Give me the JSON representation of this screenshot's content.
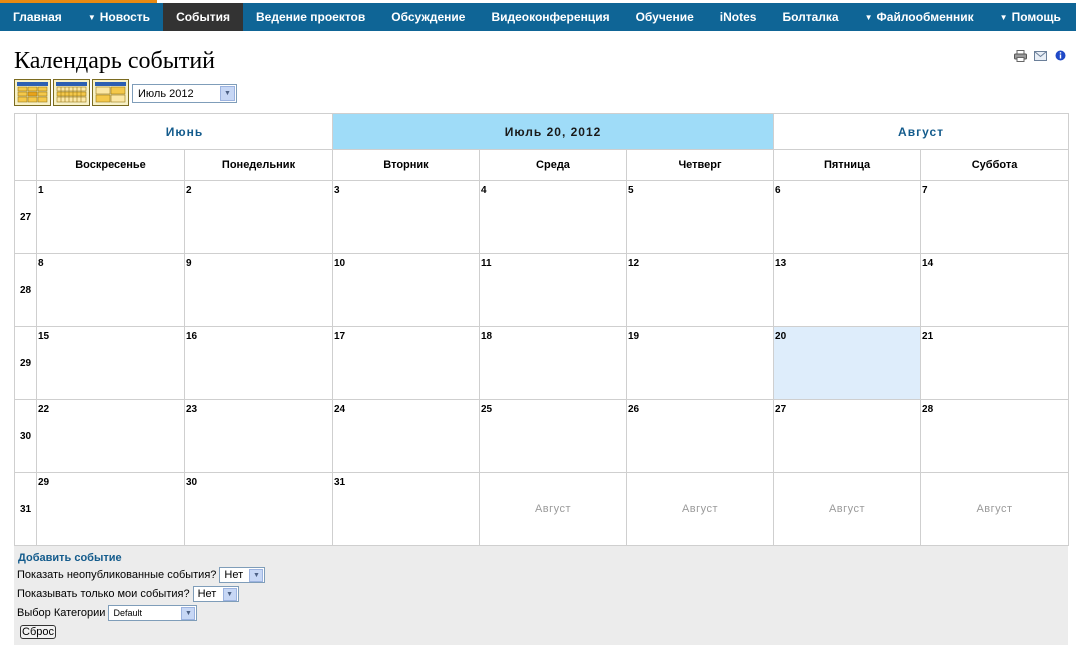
{
  "nav": {
    "items": [
      {
        "label": "Главная",
        "has_dropdown": false,
        "active": false
      },
      {
        "label": "Новость",
        "has_dropdown": true,
        "active": false
      },
      {
        "label": "События",
        "has_dropdown": false,
        "active": true
      },
      {
        "label": "Ведение проектов",
        "has_dropdown": false,
        "active": false
      },
      {
        "label": "Обсуждение",
        "has_dropdown": false,
        "active": false
      },
      {
        "label": "Видеоконференция",
        "has_dropdown": false,
        "active": false
      },
      {
        "label": "Обучение",
        "has_dropdown": false,
        "active": false
      },
      {
        "label": "iNotes",
        "has_dropdown": false,
        "active": false
      },
      {
        "label": "Болталка",
        "has_dropdown": false,
        "active": false
      },
      {
        "label": "Файлообменник",
        "has_dropdown": true,
        "active": false
      },
      {
        "label": "Помощь",
        "has_dropdown": true,
        "active": false
      }
    ],
    "dropdown_glyph": "▼"
  },
  "page": {
    "title": "Календарь событий",
    "tools": [
      "printer-icon",
      "email-icon",
      "info-icon"
    ]
  },
  "views": [
    "day-view-icon",
    "week-view-icon",
    "month-view-icon"
  ],
  "month_select": {
    "value": "Июль 2012"
  },
  "calendar": {
    "prev_month": "Июнь",
    "current": "Июль 20, 2012",
    "next_month": "Август",
    "weekdays": [
      "Воскресенье",
      "Понедельник",
      "Вторник",
      "Среда",
      "Четверг",
      "Пятница",
      "Суббота"
    ],
    "weeks": [
      {
        "num": "27",
        "days": [
          {
            "d": "1"
          },
          {
            "d": "2"
          },
          {
            "d": "3"
          },
          {
            "d": "4"
          },
          {
            "d": "5"
          },
          {
            "d": "6"
          },
          {
            "d": "7"
          }
        ]
      },
      {
        "num": "28",
        "days": [
          {
            "d": "8"
          },
          {
            "d": "9"
          },
          {
            "d": "10"
          },
          {
            "d": "11"
          },
          {
            "d": "12"
          },
          {
            "d": "13"
          },
          {
            "d": "14"
          }
        ]
      },
      {
        "num": "29",
        "days": [
          {
            "d": "15"
          },
          {
            "d": "16"
          },
          {
            "d": "17"
          },
          {
            "d": "18"
          },
          {
            "d": "19"
          },
          {
            "d": "20",
            "today": true
          },
          {
            "d": "21"
          }
        ]
      },
      {
        "num": "30",
        "days": [
          {
            "d": "22"
          },
          {
            "d": "23"
          },
          {
            "d": "24"
          },
          {
            "d": "25"
          },
          {
            "d": "26"
          },
          {
            "d": "27"
          },
          {
            "d": "28"
          }
        ]
      },
      {
        "num": "31",
        "days": [
          {
            "d": "29"
          },
          {
            "d": "30"
          },
          {
            "d": "31"
          },
          {
            "other": "Август"
          },
          {
            "other": "Август"
          },
          {
            "other": "Август"
          },
          {
            "other": "Август"
          }
        ]
      }
    ],
    "colors": {
      "header_bar": "#0f6596",
      "current_month_bg": "#9fdcf8",
      "today_bg": "#deedfb",
      "link": "#135b8c"
    }
  },
  "footer": {
    "add_event": "Добавить событие",
    "show_unpublished_label": "Показать неопубликованные события?",
    "show_unpublished_value": "Нет",
    "only_mine_label": "Показывать только мои события?",
    "only_mine_value": "Нет",
    "category_label": "Выбор Категории",
    "category_value": "Default",
    "reset_label": "Сброс"
  }
}
